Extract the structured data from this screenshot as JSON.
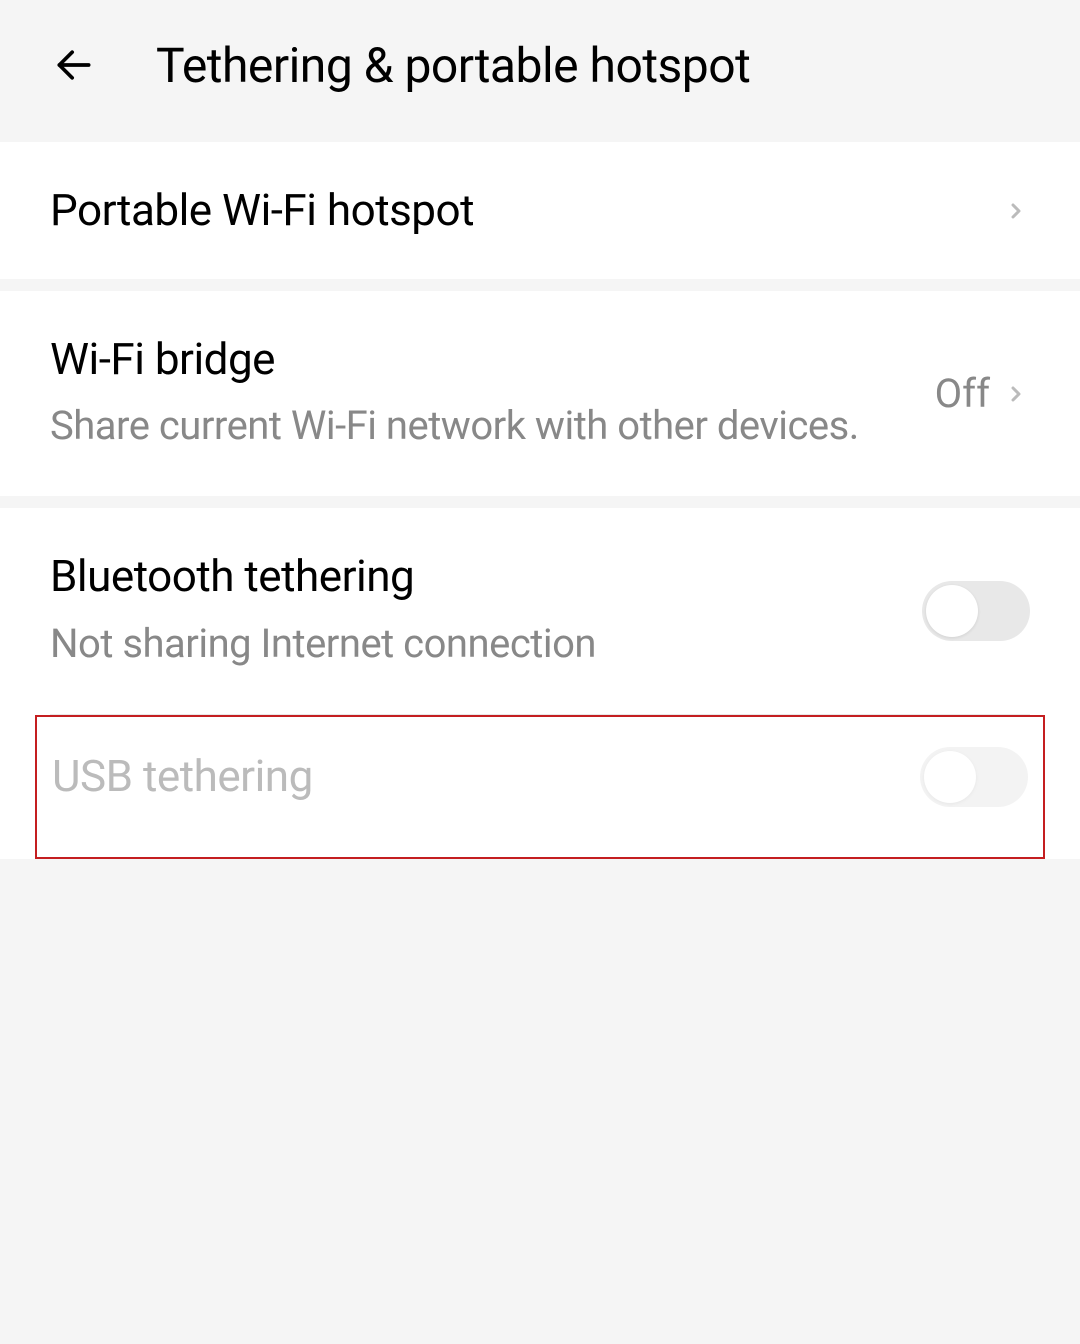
{
  "header": {
    "title": "Tethering & portable hotspot"
  },
  "rows": {
    "wifi_hotspot": {
      "title": "Portable Wi-Fi hotspot"
    },
    "wifi_bridge": {
      "title": "Wi-Fi bridge",
      "subtitle": "Share current Wi-Fi network with other devices.",
      "value": "Off"
    },
    "bluetooth_tethering": {
      "title": "Bluetooth tethering",
      "subtitle": "Not sharing Internet connection"
    },
    "usb_tethering": {
      "title": "USB tethering"
    }
  }
}
